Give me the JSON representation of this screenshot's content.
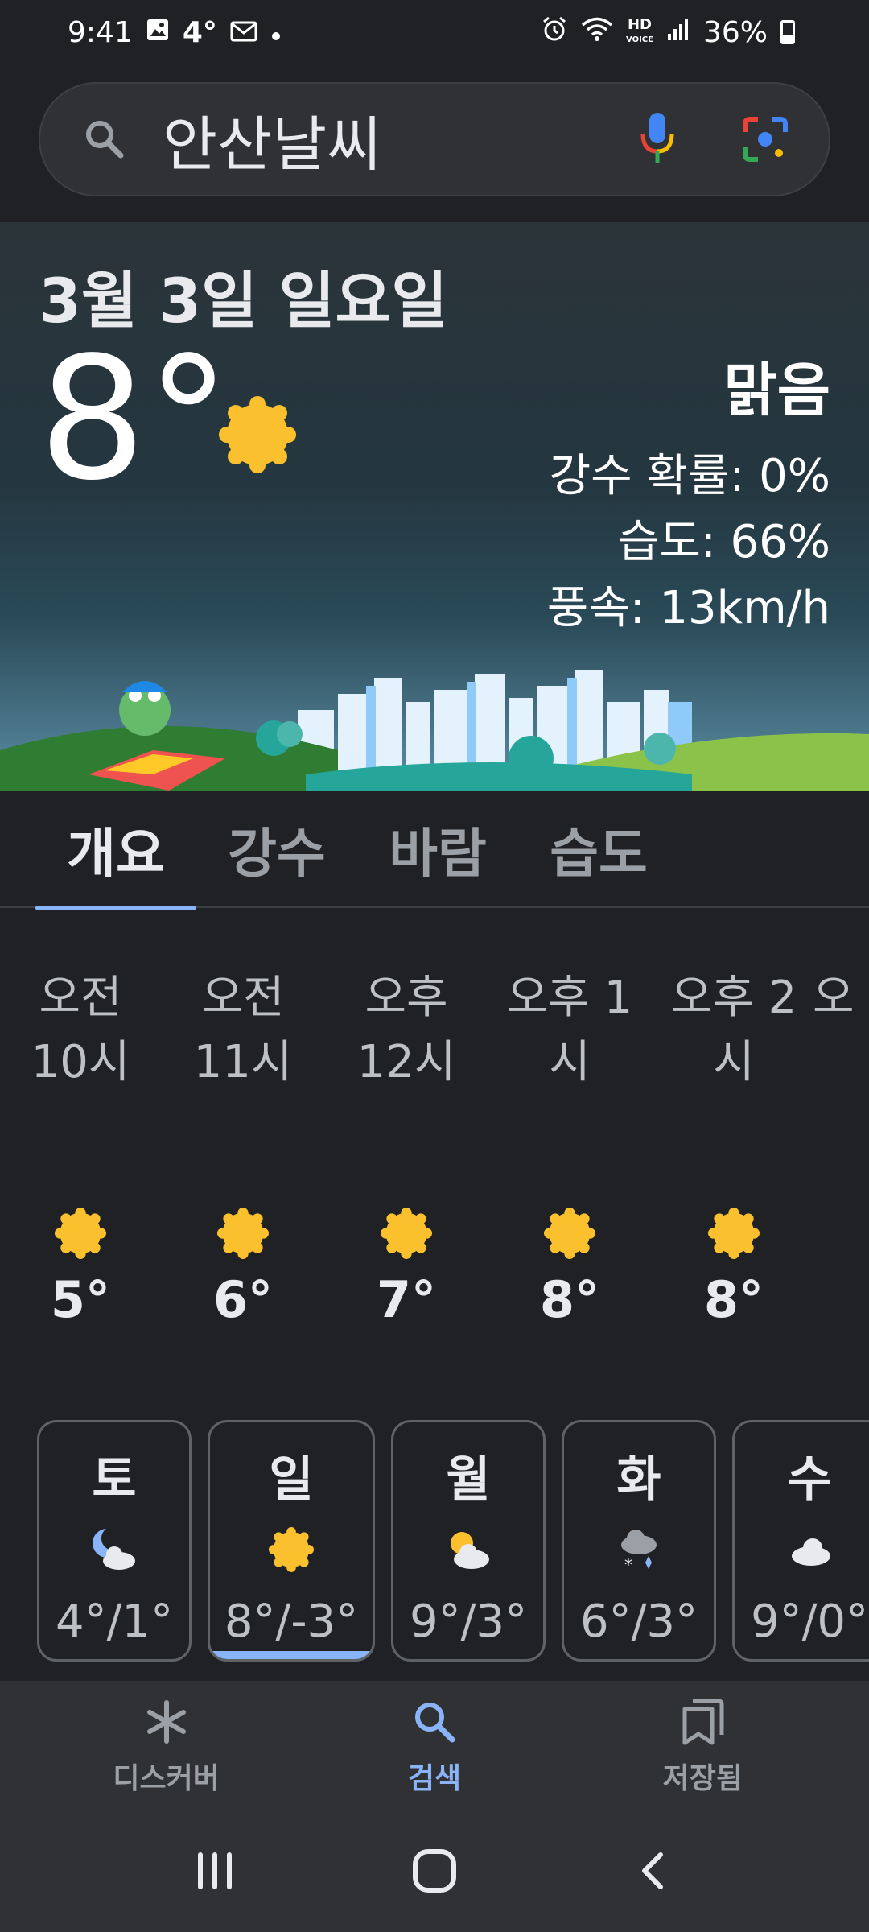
{
  "status_bar": {
    "time": "9:41",
    "temp": "4°",
    "battery": "36%",
    "left_icons": [
      "gallery-icon",
      "mail-icon",
      "dot-icon"
    ],
    "right_icons": [
      "alarm-icon",
      "wifi-icon",
      "hd-voice-icon",
      "signal-icon",
      "battery-icon"
    ],
    "hd_text": "HD"
  },
  "search": {
    "query": "안산날씨"
  },
  "weather": {
    "date": "3월 3일 일요일",
    "temperature": "8°",
    "condition": "맑음",
    "precip": "강수 확률: 0%",
    "humidity": "습도: 66%",
    "wind": "풍속: 13km/h"
  },
  "tabs": [
    {
      "label": "개요",
      "active": true
    },
    {
      "label": "강수",
      "active": false
    },
    {
      "label": "바람",
      "active": false
    },
    {
      "label": "습도",
      "active": false
    }
  ],
  "hourly": [
    {
      "line1": "오전",
      "line2": "10시",
      "temp": "5°",
      "icon": "sun-icon"
    },
    {
      "line1": "오전",
      "line2": "11시",
      "temp": "6°",
      "icon": "sun-icon"
    },
    {
      "line1": "오후",
      "line2": "12시",
      "temp": "7°",
      "icon": "sun-icon"
    },
    {
      "line1": "오후 1",
      "line2": "시",
      "temp": "8°",
      "icon": "sun-icon"
    },
    {
      "line1": "오후 2",
      "line2": "시",
      "temp": "8°",
      "icon": "sun-icon"
    },
    {
      "line1": "오",
      "line2": "",
      "temp": "",
      "icon": ""
    }
  ],
  "daily": [
    {
      "day": "토",
      "temps": "4°/1°",
      "icon": "moon-cloud-icon",
      "selected": false
    },
    {
      "day": "일",
      "temps": "8°/-3°",
      "icon": "sun-icon",
      "selected": true
    },
    {
      "day": "월",
      "temps": "9°/3°",
      "icon": "sun-cloud-icon",
      "selected": false
    },
    {
      "day": "화",
      "temps": "6°/3°",
      "icon": "snow-cloud-icon",
      "selected": false
    },
    {
      "day": "수",
      "temps": "9°/0°",
      "icon": "cloud-icon",
      "selected": false
    }
  ],
  "bottom_nav": [
    {
      "label": "디스커버",
      "icon": "discover-icon",
      "active": false
    },
    {
      "label": "검색",
      "icon": "search-icon",
      "active": true
    },
    {
      "label": "저장됨",
      "icon": "saved-icon",
      "active": false
    }
  ],
  "system_nav": [
    "recents-icon",
    "home-icon",
    "back-icon"
  ],
  "colors": {
    "background": "#202124",
    "accent": "#8ab4f8",
    "sun": "#fbc02d"
  }
}
